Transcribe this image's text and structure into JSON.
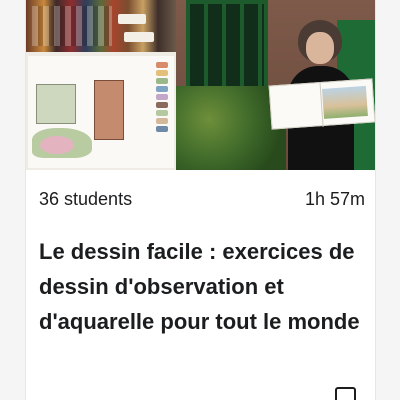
{
  "course": {
    "students": "36 students",
    "duration": "1h 57m",
    "title": "Le dessin facile : exercices de dessin d'observation et d'aquarelle pour tout le monde"
  },
  "icons": {
    "save": "bookmark-icon"
  },
  "colors": {
    "text": "#1c1d1f",
    "card": "#ffffff",
    "background": "#f5f5f5"
  }
}
